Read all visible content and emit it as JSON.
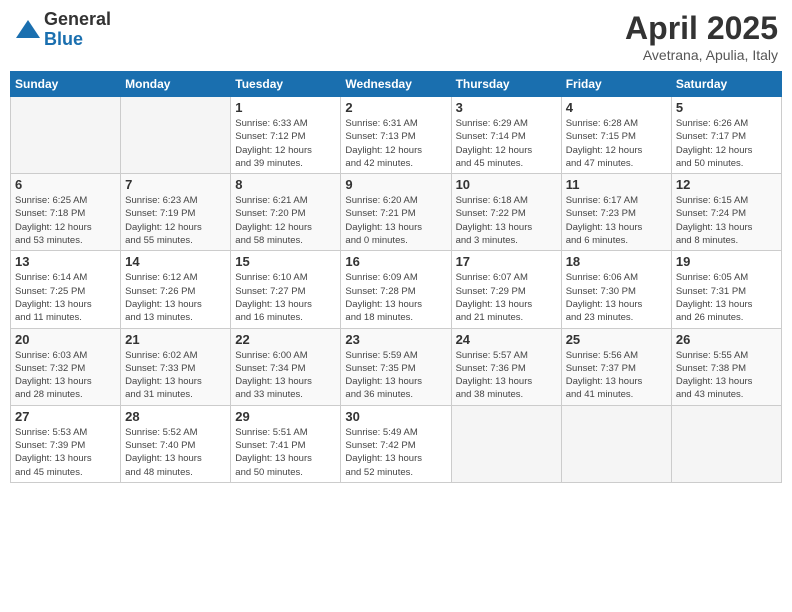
{
  "header": {
    "logo_general": "General",
    "logo_blue": "Blue",
    "month_title": "April 2025",
    "subtitle": "Avetrana, Apulia, Italy"
  },
  "days_of_week": [
    "Sunday",
    "Monday",
    "Tuesday",
    "Wednesday",
    "Thursday",
    "Friday",
    "Saturday"
  ],
  "weeks": [
    [
      {
        "day": "",
        "info": ""
      },
      {
        "day": "",
        "info": ""
      },
      {
        "day": "1",
        "info": "Sunrise: 6:33 AM\nSunset: 7:12 PM\nDaylight: 12 hours\nand 39 minutes."
      },
      {
        "day": "2",
        "info": "Sunrise: 6:31 AM\nSunset: 7:13 PM\nDaylight: 12 hours\nand 42 minutes."
      },
      {
        "day": "3",
        "info": "Sunrise: 6:29 AM\nSunset: 7:14 PM\nDaylight: 12 hours\nand 45 minutes."
      },
      {
        "day": "4",
        "info": "Sunrise: 6:28 AM\nSunset: 7:15 PM\nDaylight: 12 hours\nand 47 minutes."
      },
      {
        "day": "5",
        "info": "Sunrise: 6:26 AM\nSunset: 7:17 PM\nDaylight: 12 hours\nand 50 minutes."
      }
    ],
    [
      {
        "day": "6",
        "info": "Sunrise: 6:25 AM\nSunset: 7:18 PM\nDaylight: 12 hours\nand 53 minutes."
      },
      {
        "day": "7",
        "info": "Sunrise: 6:23 AM\nSunset: 7:19 PM\nDaylight: 12 hours\nand 55 minutes."
      },
      {
        "day": "8",
        "info": "Sunrise: 6:21 AM\nSunset: 7:20 PM\nDaylight: 12 hours\nand 58 minutes."
      },
      {
        "day": "9",
        "info": "Sunrise: 6:20 AM\nSunset: 7:21 PM\nDaylight: 13 hours\nand 0 minutes."
      },
      {
        "day": "10",
        "info": "Sunrise: 6:18 AM\nSunset: 7:22 PM\nDaylight: 13 hours\nand 3 minutes."
      },
      {
        "day": "11",
        "info": "Sunrise: 6:17 AM\nSunset: 7:23 PM\nDaylight: 13 hours\nand 6 minutes."
      },
      {
        "day": "12",
        "info": "Sunrise: 6:15 AM\nSunset: 7:24 PM\nDaylight: 13 hours\nand 8 minutes."
      }
    ],
    [
      {
        "day": "13",
        "info": "Sunrise: 6:14 AM\nSunset: 7:25 PM\nDaylight: 13 hours\nand 11 minutes."
      },
      {
        "day": "14",
        "info": "Sunrise: 6:12 AM\nSunset: 7:26 PM\nDaylight: 13 hours\nand 13 minutes."
      },
      {
        "day": "15",
        "info": "Sunrise: 6:10 AM\nSunset: 7:27 PM\nDaylight: 13 hours\nand 16 minutes."
      },
      {
        "day": "16",
        "info": "Sunrise: 6:09 AM\nSunset: 7:28 PM\nDaylight: 13 hours\nand 18 minutes."
      },
      {
        "day": "17",
        "info": "Sunrise: 6:07 AM\nSunset: 7:29 PM\nDaylight: 13 hours\nand 21 minutes."
      },
      {
        "day": "18",
        "info": "Sunrise: 6:06 AM\nSunset: 7:30 PM\nDaylight: 13 hours\nand 23 minutes."
      },
      {
        "day": "19",
        "info": "Sunrise: 6:05 AM\nSunset: 7:31 PM\nDaylight: 13 hours\nand 26 minutes."
      }
    ],
    [
      {
        "day": "20",
        "info": "Sunrise: 6:03 AM\nSunset: 7:32 PM\nDaylight: 13 hours\nand 28 minutes."
      },
      {
        "day": "21",
        "info": "Sunrise: 6:02 AM\nSunset: 7:33 PM\nDaylight: 13 hours\nand 31 minutes."
      },
      {
        "day": "22",
        "info": "Sunrise: 6:00 AM\nSunset: 7:34 PM\nDaylight: 13 hours\nand 33 minutes."
      },
      {
        "day": "23",
        "info": "Sunrise: 5:59 AM\nSunset: 7:35 PM\nDaylight: 13 hours\nand 36 minutes."
      },
      {
        "day": "24",
        "info": "Sunrise: 5:57 AM\nSunset: 7:36 PM\nDaylight: 13 hours\nand 38 minutes."
      },
      {
        "day": "25",
        "info": "Sunrise: 5:56 AM\nSunset: 7:37 PM\nDaylight: 13 hours\nand 41 minutes."
      },
      {
        "day": "26",
        "info": "Sunrise: 5:55 AM\nSunset: 7:38 PM\nDaylight: 13 hours\nand 43 minutes."
      }
    ],
    [
      {
        "day": "27",
        "info": "Sunrise: 5:53 AM\nSunset: 7:39 PM\nDaylight: 13 hours\nand 45 minutes."
      },
      {
        "day": "28",
        "info": "Sunrise: 5:52 AM\nSunset: 7:40 PM\nDaylight: 13 hours\nand 48 minutes."
      },
      {
        "day": "29",
        "info": "Sunrise: 5:51 AM\nSunset: 7:41 PM\nDaylight: 13 hours\nand 50 minutes."
      },
      {
        "day": "30",
        "info": "Sunrise: 5:49 AM\nSunset: 7:42 PM\nDaylight: 13 hours\nand 52 minutes."
      },
      {
        "day": "",
        "info": ""
      },
      {
        "day": "",
        "info": ""
      },
      {
        "day": "",
        "info": ""
      }
    ]
  ]
}
